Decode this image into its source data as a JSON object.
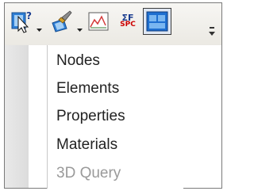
{
  "menu": {
    "items": [
      {
        "label": "Nodes",
        "enabled": true
      },
      {
        "label": "Elements",
        "enabled": true
      },
      {
        "label": "Properties",
        "enabled": true
      },
      {
        "label": "Materials",
        "enabled": true
      },
      {
        "label": "3D Query",
        "enabled": false
      }
    ]
  },
  "toolbar": {
    "query_icon_glyph": "?",
    "spc_top": "ΣF",
    "spc_bottom": "SPC",
    "icons": [
      "query-cursor-icon",
      "paint-brush-icon",
      "graph-icon",
      "spc-force-icon",
      "window-layout-icon"
    ]
  },
  "colors": {
    "accent_blue": "#1e6fd0",
    "spc_red": "#cc0000",
    "menu_text": "#222222",
    "disabled_text": "#9a9a9a"
  }
}
